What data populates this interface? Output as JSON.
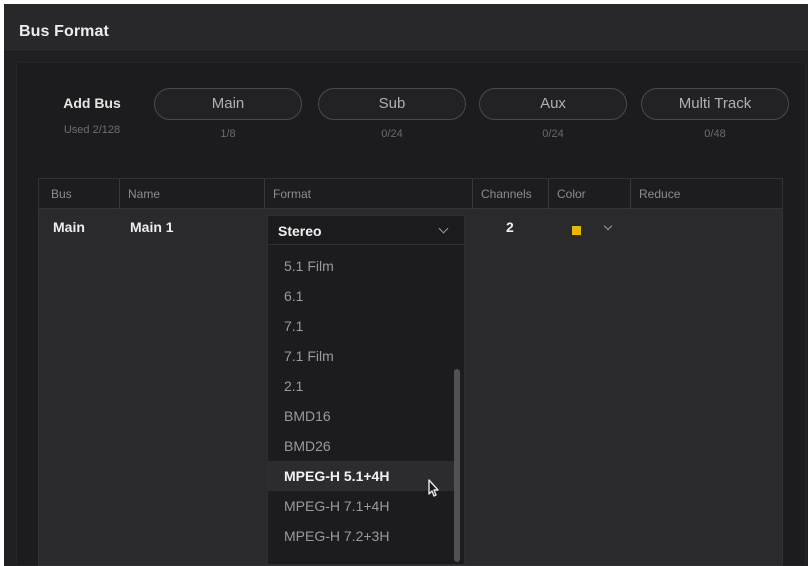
{
  "window": {
    "title": "Bus Format"
  },
  "add_bus": {
    "label": "Add Bus",
    "used": "Used 2/128",
    "buttons": [
      {
        "label": "Main",
        "count": "1/8"
      },
      {
        "label": "Sub",
        "count": "0/24"
      },
      {
        "label": "Aux",
        "count": "0/24"
      },
      {
        "label": "Multi Track",
        "count": "0/48"
      }
    ]
  },
  "table": {
    "columns": [
      "Bus",
      "Name",
      "Format",
      "Channels",
      "Color",
      "Reduce"
    ],
    "rows": [
      {
        "bus": "Main",
        "name": "Main 1",
        "format": "Stereo",
        "channels": "2",
        "color": "#e6b800"
      }
    ]
  },
  "format_dropdown": {
    "options": [
      "5.1 Film",
      "6.1",
      "7.1",
      "7.1 Film",
      "2.1",
      "BMD16",
      "BMD26",
      "MPEG-H 5.1+4H",
      "MPEG-H 7.1+4H",
      "MPEG-H 7.2+3H"
    ],
    "highlighted": "MPEG-H 5.1+4H"
  }
}
